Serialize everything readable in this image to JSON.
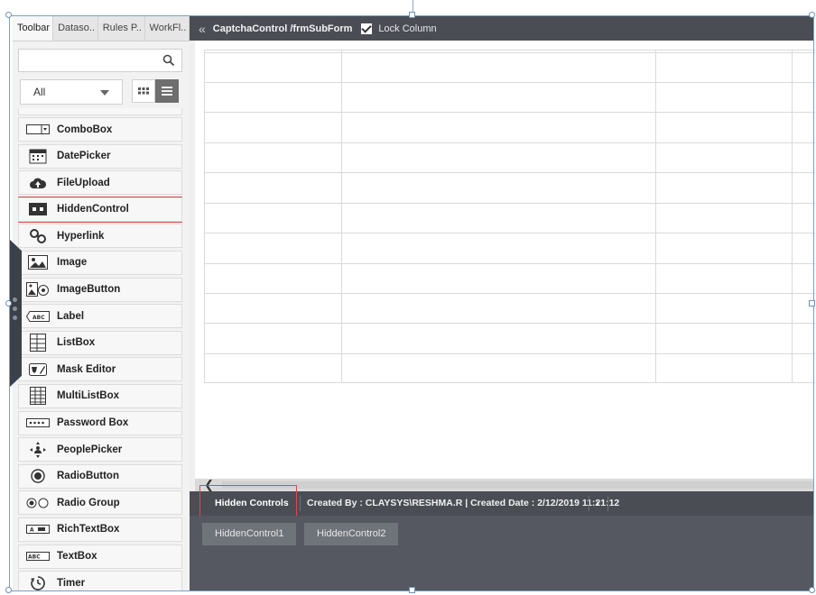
{
  "left_panel": {
    "tabs": [
      {
        "label": "Toolbar",
        "active": true
      },
      {
        "label": "Dataso.."
      },
      {
        "label": "Rules P.."
      },
      {
        "label": "WorkFl.."
      }
    ],
    "search": {
      "value": "",
      "placeholder": ""
    },
    "filter": {
      "selected": "All"
    },
    "controls": [
      {
        "label": "ComboBox",
        "icon": "combobox-icon"
      },
      {
        "label": "DatePicker",
        "icon": "calendar-icon"
      },
      {
        "label": "FileUpload",
        "icon": "cloud-upload-icon"
      },
      {
        "label": "HiddenControl",
        "icon": "hidden-control-icon",
        "highlighted": true
      },
      {
        "label": "Hyperlink",
        "icon": "link-icon"
      },
      {
        "label": "Image",
        "icon": "image-icon"
      },
      {
        "label": "ImageButton",
        "icon": "image-button-icon"
      },
      {
        "label": "Label",
        "icon": "label-icon"
      },
      {
        "label": "ListBox",
        "icon": "listbox-icon"
      },
      {
        "label": "Mask Editor",
        "icon": "mask-editor-icon"
      },
      {
        "label": "MultiListBox",
        "icon": "multilistbox-icon"
      },
      {
        "label": "Password Box",
        "icon": "password-icon"
      },
      {
        "label": "PeoplePicker",
        "icon": "people-picker-icon"
      },
      {
        "label": "RadioButton",
        "icon": "radio-button-icon"
      },
      {
        "label": "Radio Group",
        "icon": "radio-group-icon"
      },
      {
        "label": "RichTextBox",
        "icon": "richtextbox-icon"
      },
      {
        "label": "TextBox",
        "icon": "textbox-icon"
      },
      {
        "label": "Timer",
        "icon": "timer-icon"
      }
    ]
  },
  "header": {
    "breadcrumb": "CaptchaControl /frmSubForm",
    "lock_column_label": "Lock Column",
    "lock_column_checked": true
  },
  "status_bar": {
    "hidden_controls_label": "Hidden Controls",
    "created_info": "Created By : CLAYSYS\\RESHMA.R | Created Date : 2/12/2019 11:21:12"
  },
  "hidden_controls": [
    "HiddenControl1",
    "HiddenControl2"
  ],
  "colors": {
    "dark_bar": "#4a4d54",
    "hidden_area": "#555860",
    "highlight": "#e04a4a",
    "panel": "#f2f2f2"
  }
}
